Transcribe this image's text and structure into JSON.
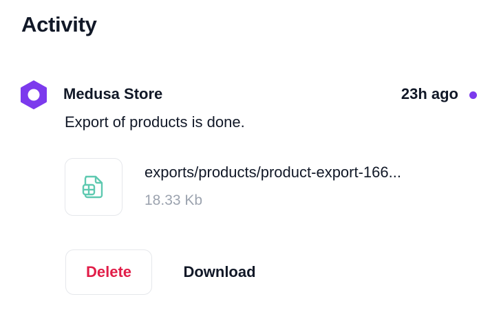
{
  "activity": {
    "title": "Activity"
  },
  "notification": {
    "sender": "Medusa Store",
    "time": "23h ago",
    "message": "Export of products is done.",
    "unread": true,
    "avatar_color": "#7c3aed",
    "dot_color": "#7c3aed",
    "file": {
      "name": "exports/products/product-export-166...",
      "size": "18.33 Kb",
      "icon": "spreadsheet-file-icon",
      "icon_color": "#5ec9b0"
    },
    "actions": {
      "delete_label": "Delete",
      "delete_color": "#e11d48",
      "download_label": "Download"
    }
  }
}
